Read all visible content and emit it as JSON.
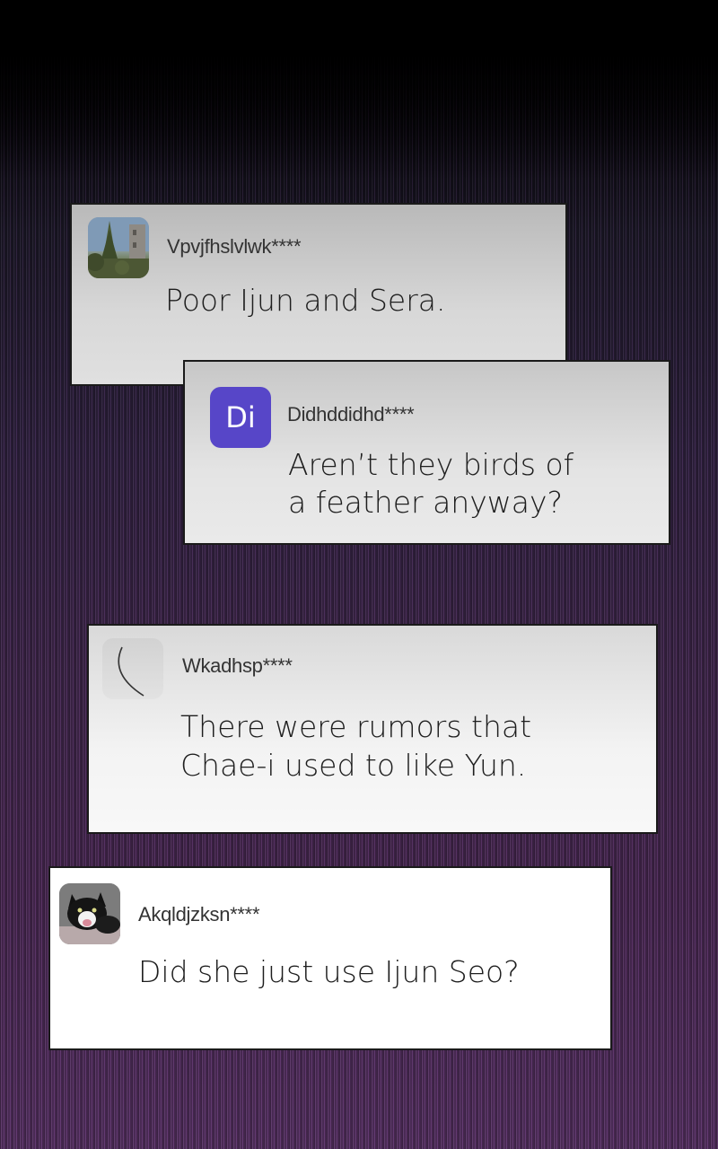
{
  "comments": [
    {
      "username": "Vpvjfhslvlwk****",
      "text_lines": [
        "Poor Ijun and Sera."
      ],
      "avatar_icon": "landscape-photo-avatar"
    },
    {
      "username": "Didhddidhd****",
      "text_lines": [
        "Aren’t they birds of",
        "a feather anyway?"
      ],
      "avatar_icon": "letter-avatar",
      "avatar_text": "Di",
      "avatar_color": "#5746c8"
    },
    {
      "username": "Wkadhsp****",
      "text_lines": [
        "There were rumors that",
        "Chae-i used to like Yun."
      ],
      "avatar_icon": "moon-sketch-avatar"
    },
    {
      "username": "Akqldjzksn****",
      "text_lines": [
        "Did she just use Ijun Seo?"
      ],
      "avatar_icon": "cat-photo-avatar"
    }
  ]
}
